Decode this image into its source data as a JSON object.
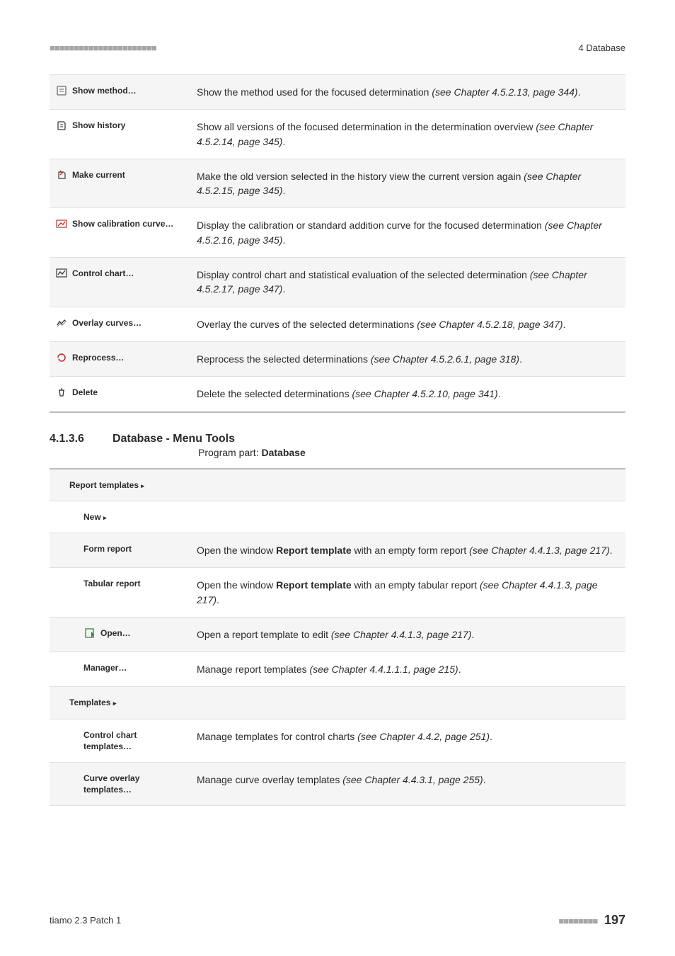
{
  "header": {
    "section": "4 Database"
  },
  "rows1": [
    {
      "alt": true,
      "icon": "method-icon",
      "label": "Show method…",
      "desc_pre": "Show the method used for the focused determination ",
      "desc_italic": "(see Chapter 4.5.2.13, page 344)",
      "desc_post": "."
    },
    {
      "alt": false,
      "icon": "history-icon",
      "label": "Show history",
      "desc_pre": "Show all versions of the focused determination in the determination overview ",
      "desc_italic": "(see Chapter 4.5.2.14, page 345)",
      "desc_post": "."
    },
    {
      "alt": true,
      "icon": "make-current-icon",
      "label": "Make current",
      "desc_pre": "Make the old version selected in the history view the current version again ",
      "desc_italic": "(see Chapter 4.5.2.15, page 345)",
      "desc_post": "."
    },
    {
      "alt": false,
      "icon": "calibration-icon",
      "label": "Show calibration curve…",
      "desc_pre": "Display the calibration or standard addition curve for the focused determination ",
      "desc_italic": "(see Chapter 4.5.2.16, page 345)",
      "desc_post": "."
    },
    {
      "alt": true,
      "icon": "chart-icon",
      "label": "Control chart…",
      "desc_pre": "Display control chart and statistical evaluation of the selected determination ",
      "desc_italic": "(see Chapter 4.5.2.17, page 347)",
      "desc_post": "."
    },
    {
      "alt": false,
      "icon": "overlay-icon",
      "label": "Overlay curves…",
      "desc_pre": "Overlay the curves of the selected determinations ",
      "desc_italic": "(see Chapter 4.5.2.18, page 347)",
      "desc_post": "."
    },
    {
      "alt": true,
      "icon": "reprocess-icon",
      "label": "Reprocess…",
      "desc_pre": "Reprocess the selected determinations ",
      "desc_italic": "(see Chapter 4.5.2.6.1, page 318)",
      "desc_post": "."
    },
    {
      "alt": false,
      "icon": "delete-icon",
      "label": "Delete",
      "desc_pre": "Delete the selected determinations ",
      "desc_italic": "(see Chapter 4.5.2.10, page 341)",
      "desc_post": "."
    }
  ],
  "section": {
    "number": "4.1.3.6",
    "title": "Database - Menu Tools",
    "program_part_label": "Program part: ",
    "program_part_value": "Database"
  },
  "rows2": [
    {
      "alt": true,
      "icon": "",
      "indent": 1,
      "label": "Report templates ▸",
      "desc_html": ""
    },
    {
      "alt": false,
      "icon": "",
      "indent": 2,
      "label": "New ▸",
      "desc_html": ""
    },
    {
      "alt": true,
      "icon": "",
      "indent": 2,
      "label": "Form report",
      "desc_html": "Open the window <b>Report template</b> with an empty form report <i>(see Chapter 4.4.1.3, page 217)</i>."
    },
    {
      "alt": false,
      "icon": "",
      "indent": 2,
      "label": "Tabular report",
      "desc_html": "Open the window <b>Report template</b> with an empty tabular report <i>(see Chapter 4.4.1.3, page 217)</i>."
    },
    {
      "alt": true,
      "icon": "open-icon",
      "indent": 2,
      "label": "Open…",
      "desc_html": "Open a report template to edit <i>(see Chapter 4.4.1.3, page 217)</i>."
    },
    {
      "alt": false,
      "icon": "",
      "indent": 2,
      "label": "Manager…",
      "desc_html": "Manage report templates <i>(see Chapter 4.4.1.1.1, page 215)</i>."
    },
    {
      "alt": true,
      "icon": "",
      "indent": 1,
      "label": "Templates ▸",
      "desc_html": ""
    },
    {
      "alt": false,
      "icon": "",
      "indent": 2,
      "label": "Control chart templates…",
      "desc_html": "Manage templates for control charts <i>(see Chapter 4.4.2, page 251)</i>."
    },
    {
      "alt": true,
      "icon": "",
      "indent": 2,
      "label": "Curve overlay templates…",
      "desc_html": "Manage curve overlay templates <i>(see Chapter 4.4.3.1, page 255)</i>."
    }
  ],
  "footer": {
    "left": "tiamo 2.3 Patch 1",
    "page": "197"
  }
}
